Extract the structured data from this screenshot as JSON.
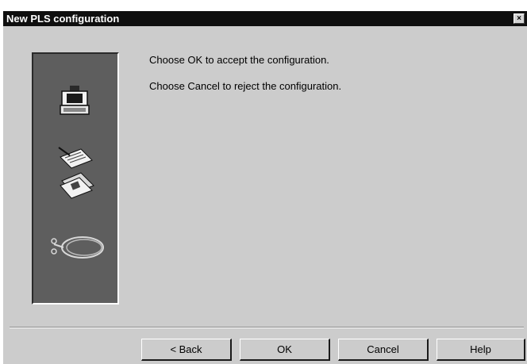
{
  "window": {
    "title": "New PLS configuration",
    "close_glyph": "×"
  },
  "messages": {
    "ok_text": "Choose OK to accept the configuration.",
    "cancel_text": "Choose Cancel to reject the configuration."
  },
  "side_panel": {
    "icons": [
      "laser-scanner-icon",
      "configuration-documents-icon",
      "cable-icon"
    ]
  },
  "buttons": {
    "back": "< Back",
    "ok": "OK",
    "cancel": "Cancel",
    "help": "Help"
  },
  "colors": {
    "dialog_background": "#cccccc",
    "title_bar": "#0f0f0f",
    "side_panel": "#5e5e5e"
  }
}
